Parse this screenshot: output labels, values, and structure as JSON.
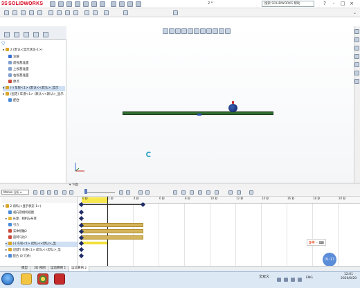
{
  "app": {
    "brand_prefix": "3S",
    "brand_name": "SOLIDWORKS",
    "doc_title": "2 *",
    "search_placeholder": "搜索 SOLIDWORKS 帮助",
    "window_controls": [
      "?",
      "-",
      "□",
      "×"
    ]
  },
  "feature_tree": {
    "root": "2 (默认<显示状态-1>)",
    "items": [
      {
        "label": "注解",
        "icon": "annotation-icon",
        "color": "#3a6fd6"
      },
      {
        "label": "前视基准面",
        "icon": "plane-icon",
        "color": "#7f9fcf"
      },
      {
        "label": "上视基准面",
        "icon": "plane-icon",
        "color": "#7f9fcf"
      },
      {
        "label": "右视基准面",
        "icon": "plane-icon",
        "color": "#7f9fcf"
      },
      {
        "label": "原点",
        "icon": "origin-icon",
        "color": "#c94a3a"
      },
      {
        "label": "(-) 车轮<1> (默认<<默认>_显示",
        "icon": "part-icon",
        "color": "#d9a528",
        "highlight": true
      },
      {
        "label": "(固定) 车道<1> (默认<<默认>_显示",
        "icon": "part-icon",
        "color": "#d9a528"
      },
      {
        "label": "配合",
        "icon": "mates-icon",
        "color": "#4a8bd8"
      }
    ]
  },
  "motion": {
    "header_label": "下面",
    "type": "Motion 分析",
    "ruler_ticks": [
      "0 秒",
      "2 秒",
      "4 秒",
      "6 秒",
      "8 秒",
      "10 秒",
      "12 秒",
      "14 秒",
      "16 秒",
      "18 秒",
      "20 秒",
      "22 秒"
    ],
    "tree_root": "2 (默认<显示状态-1>)",
    "tree_items": [
      {
        "label": "视向及相机视图",
        "icon": "camera-icon",
        "color": "#4a8bd8"
      },
      {
        "label": "光源、相机与布景",
        "icon": "light-icon",
        "color": "#e2b93a"
      },
      {
        "label": "引力",
        "icon": "gravity-icon",
        "color": "#4a8bd8"
      },
      {
        "label": "实体接触2",
        "icon": "contact-icon",
        "color": "#c94a3a"
      },
      {
        "label": "旋转马达2",
        "icon": "motor-icon",
        "color": "#c94a3a"
      },
      {
        "label": "(-) 车轮<1> (默认<<默认>_显",
        "icon": "part-icon",
        "color": "#d9a528",
        "highlight": true
      },
      {
        "label": "(固定) 车道<1> (默认<<默认>_显",
        "icon": "part-icon",
        "color": "#d9a528"
      },
      {
        "label": "配合 (0 冗余)",
        "icon": "mates-icon",
        "color": "#4a8bd8"
      }
    ]
  },
  "bottom_tabs": [
    "模型",
    "3D 视图",
    "运动算例 1",
    "运动算例 2"
  ],
  "ime_label": "S中",
  "time_bubble": "01:17",
  "taskbar": {
    "lang": "文双义",
    "tray_labels": [
      "ENG"
    ],
    "clock_time": "12:01",
    "clock_date": "2020/8/20"
  },
  "colors": {
    "beam": "#2f6b2f",
    "wheel": "#14307a",
    "timeline_bar": "#d4b45a",
    "ruler_highlight": "#f7e84f"
  }
}
